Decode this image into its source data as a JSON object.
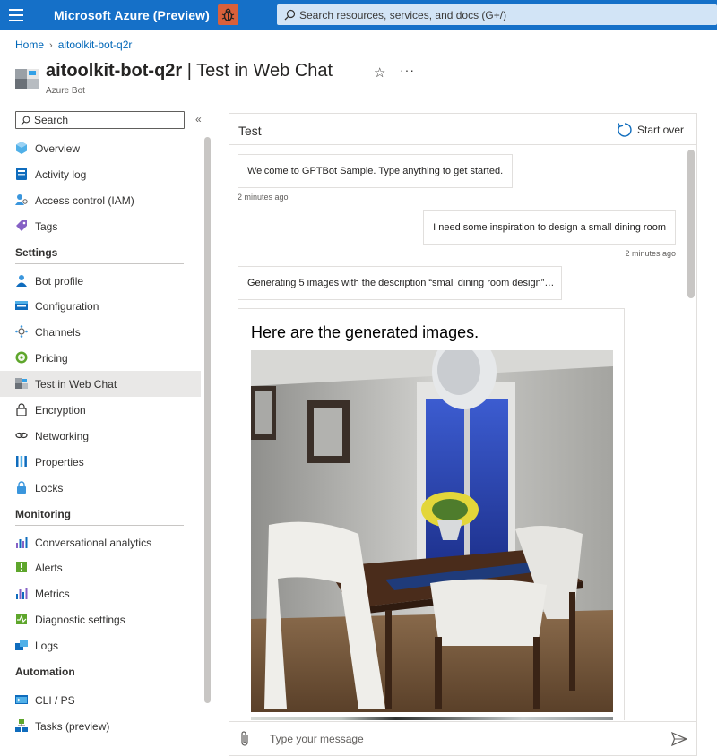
{
  "topbar": {
    "brand": "Microsoft Azure (Preview)",
    "search_placeholder": "Search resources, services, and docs (G+/)"
  },
  "breadcrumb": {
    "home": "Home",
    "resource": "aitoolkit-bot-q2r"
  },
  "header": {
    "resource_name": "aitoolkit-bot-q2r",
    "separator": " | ",
    "blade_name": "Test in Web Chat",
    "subtitle": "Azure Bot"
  },
  "sidebar": {
    "search_placeholder": "Search",
    "top_items": [
      {
        "label": "Overview",
        "icon": "overview-icon"
      },
      {
        "label": "Activity log",
        "icon": "activity-log-icon"
      },
      {
        "label": "Access control (IAM)",
        "icon": "iam-icon"
      },
      {
        "label": "Tags",
        "icon": "tag-icon"
      }
    ],
    "settings_heading": "Settings",
    "settings_items": [
      {
        "label": "Bot profile",
        "icon": "bot-profile-icon"
      },
      {
        "label": "Configuration",
        "icon": "configuration-icon"
      },
      {
        "label": "Channels",
        "icon": "channels-icon"
      },
      {
        "label": "Pricing",
        "icon": "pricing-icon"
      },
      {
        "label": "Test in Web Chat",
        "icon": "web-chat-icon",
        "active": true
      },
      {
        "label": "Encryption",
        "icon": "lock-icon"
      },
      {
        "label": "Networking",
        "icon": "networking-icon"
      },
      {
        "label": "Properties",
        "icon": "properties-icon"
      },
      {
        "label": "Locks",
        "icon": "locks-icon"
      }
    ],
    "monitoring_heading": "Monitoring",
    "monitoring_items": [
      {
        "label": "Conversational analytics",
        "icon": "analytics-icon"
      },
      {
        "label": "Alerts",
        "icon": "alerts-icon"
      },
      {
        "label": "Metrics",
        "icon": "metrics-icon"
      },
      {
        "label": "Diagnostic settings",
        "icon": "diagnostic-icon"
      },
      {
        "label": "Logs",
        "icon": "logs-icon"
      }
    ],
    "automation_heading": "Automation",
    "automation_items": [
      {
        "label": "CLI / PS",
        "icon": "cli-icon"
      },
      {
        "label": "Tasks (preview)",
        "icon": "tasks-icon"
      }
    ]
  },
  "chat": {
    "title": "Test",
    "start_over": "Start over",
    "messages": [
      {
        "from": "bot",
        "text": "Welcome to GPTBot Sample. Type anything to get started.",
        "time": "2 minutes ago"
      },
      {
        "from": "user",
        "text": "I need some inspiration to design a small dining room",
        "time": "2 minutes ago"
      },
      {
        "from": "bot",
        "text": "Generating 5 images with the description “small dining room design”…"
      }
    ],
    "card_title": "Here are the generated images.",
    "input_placeholder": "Type your message"
  },
  "colors": {
    "topbar": "#1570c8",
    "link": "#0067b8",
    "active_nav": "#e9e8e7"
  }
}
